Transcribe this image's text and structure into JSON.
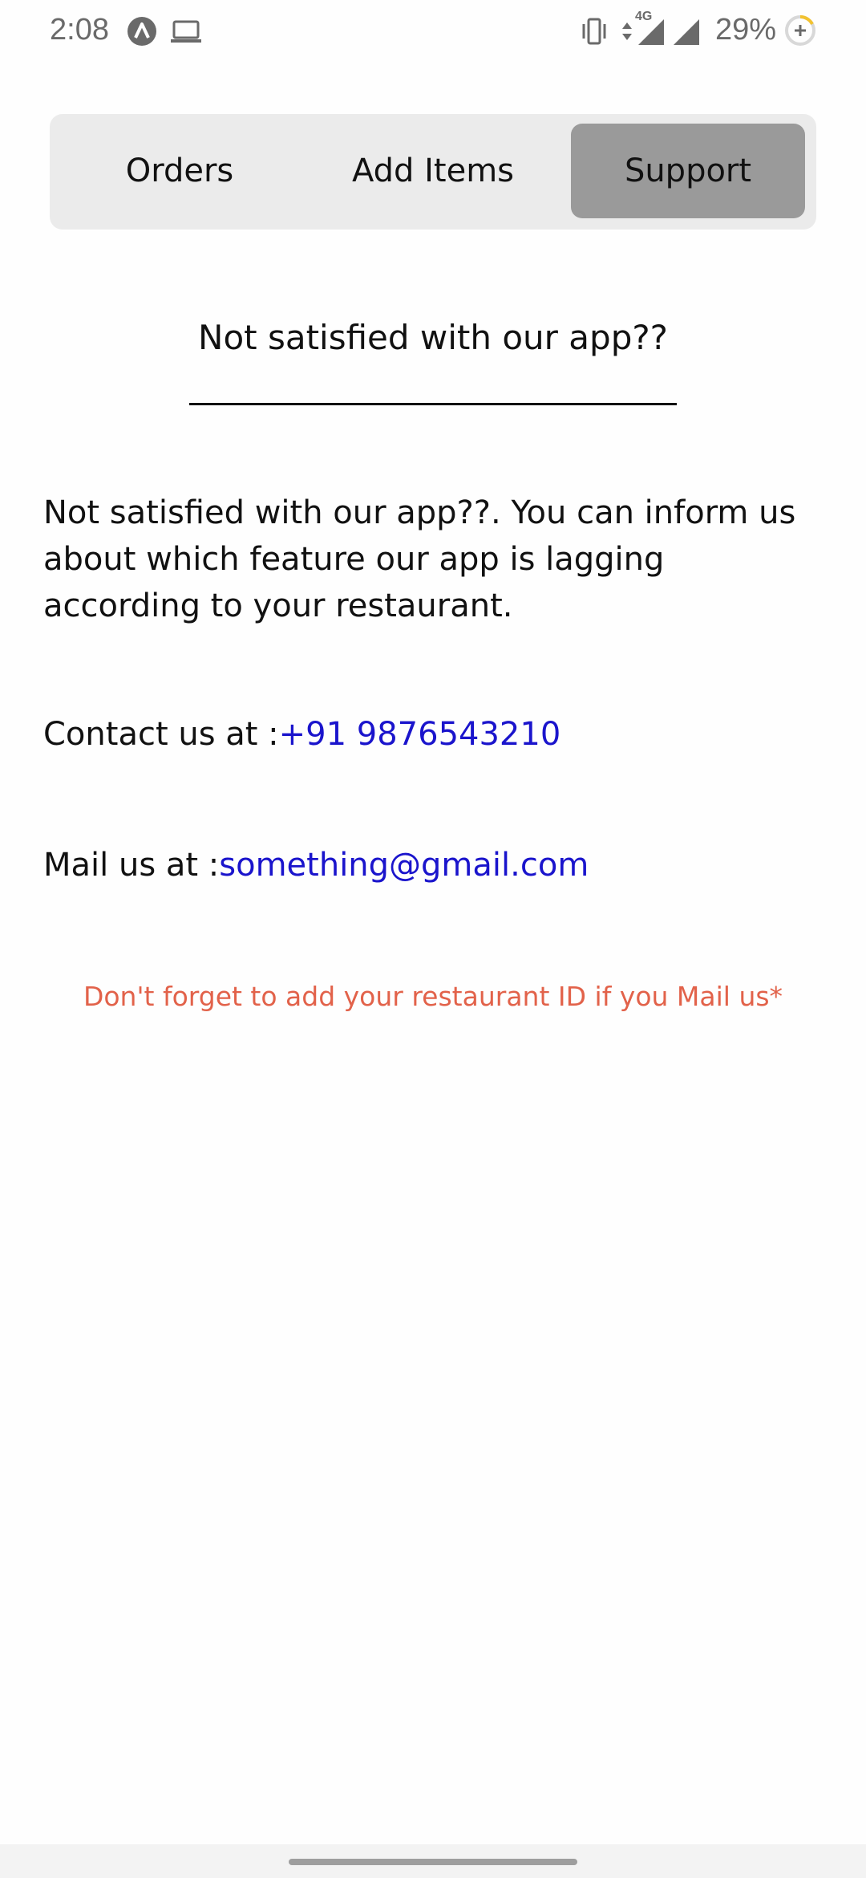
{
  "status_bar": {
    "time": "2:08",
    "battery": "29%",
    "network": "4G",
    "icons": [
      "app-notification-icon",
      "laptop-icon",
      "vibrate-icon",
      "data-arrows-icon",
      "signal-icon",
      "signal-icon-2",
      "battery-saver-icon"
    ]
  },
  "tabs": [
    {
      "label": "Orders",
      "active": false
    },
    {
      "label": "Add Items",
      "active": false
    },
    {
      "label": "Support",
      "active": true
    }
  ],
  "support": {
    "heading": "Not satisfied with our app??",
    "message": "Not satisfied with our app??. You can inform us about which feature our app is lagging according to your restaurant.",
    "contact_label": "Contact us at :",
    "contact_phone": "+91 9876543210",
    "mail_label": "Mail us at :",
    "mail_address": "something@gmail.com",
    "note": "Don't forget to add your restaurant ID if you Mail us*"
  },
  "colors": {
    "active_tab": "#9a9a9a",
    "tabbar_bg": "#ebebeb",
    "link": "#1a14cc",
    "note": "#e2624a"
  }
}
